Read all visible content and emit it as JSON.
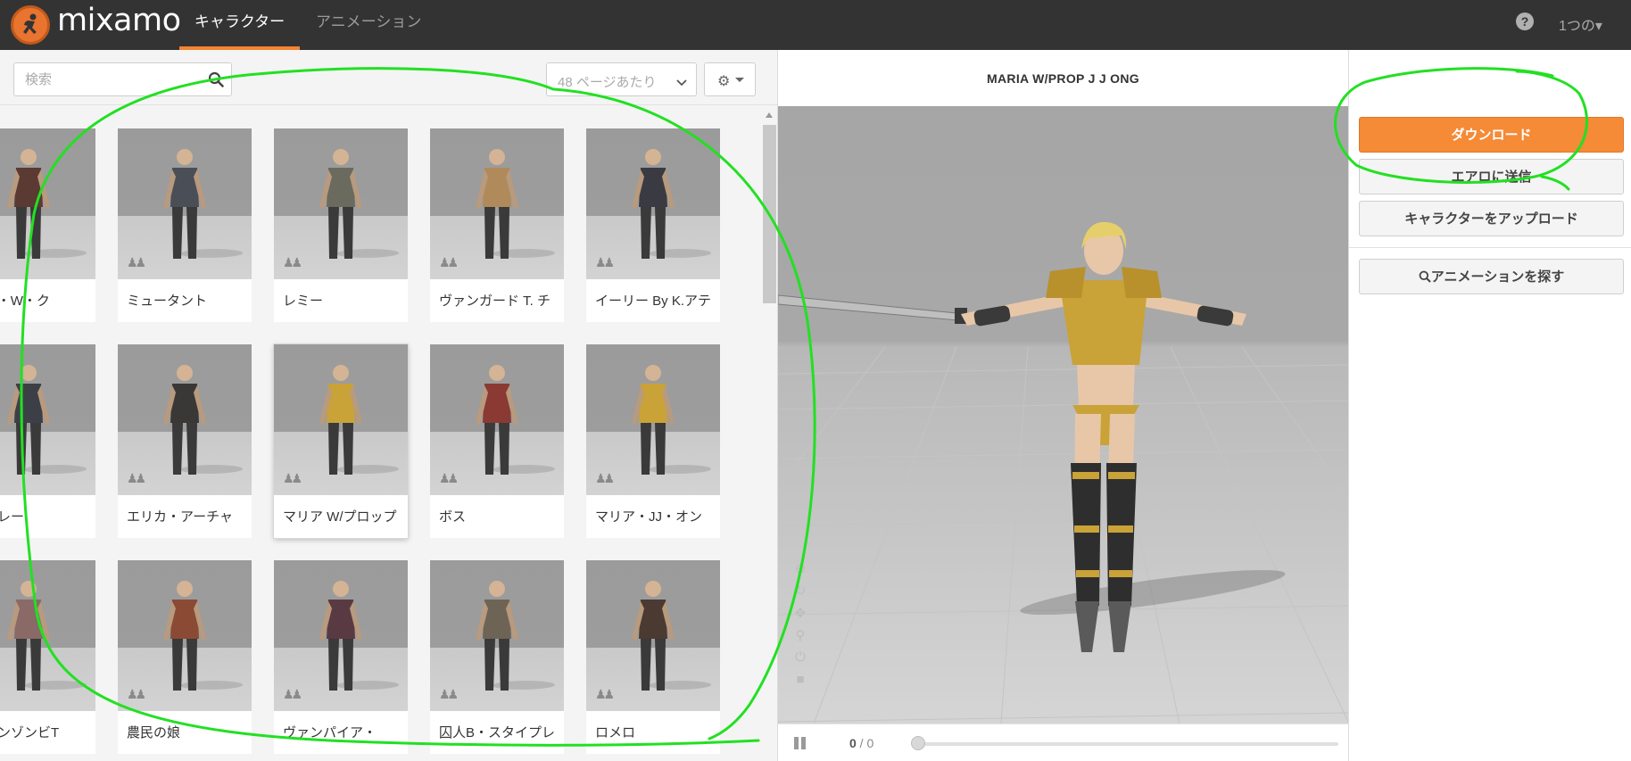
{
  "nav": {
    "brand": "mixamo",
    "tabs": [
      {
        "label": "キャラクター",
        "active": true
      },
      {
        "label": "アニメーション",
        "active": false
      }
    ],
    "help_icon": "question-circle-icon",
    "account_label": "1つの▾"
  },
  "toolbar": {
    "search_placeholder": "検索",
    "per_page": "48 ページあたり"
  },
  "characters": [
    {
      "label": "ック・W・ク"
    },
    {
      "label": "ミュータント"
    },
    {
      "label": "レミー"
    },
    {
      "label": "ヴァンガード T. チ"
    },
    {
      "label": "イーリー By K.アテ"
    },
    {
      "label": "ングレー"
    },
    {
      "label": "エリカ・アーチャ"
    },
    {
      "label": "マリア W/プロップ",
      "selected": true
    },
    {
      "label": "ボス"
    },
    {
      "label": "マリア・JJ・オン"
    },
    {
      "label": "ルトンゾンビT"
    },
    {
      "label": "農民の娘"
    },
    {
      "label": "ヴァンパイア・"
    },
    {
      "label": "囚人B・スタイプレ"
    },
    {
      "label": "ロメロ"
    }
  ],
  "viewer": {
    "title": "MARIA W/PROP J J ONG",
    "frame_current": "0",
    "frame_total": " / 0"
  },
  "actions": {
    "download": "ダウンロード",
    "send_to_aero": "エアロに送信",
    "upload_character": "キャラクターをアップロード",
    "find_animations": "アニメーションを探す"
  },
  "colors": {
    "accent": "#f58331",
    "topbar": "#333333",
    "annotation": "#22e022"
  }
}
